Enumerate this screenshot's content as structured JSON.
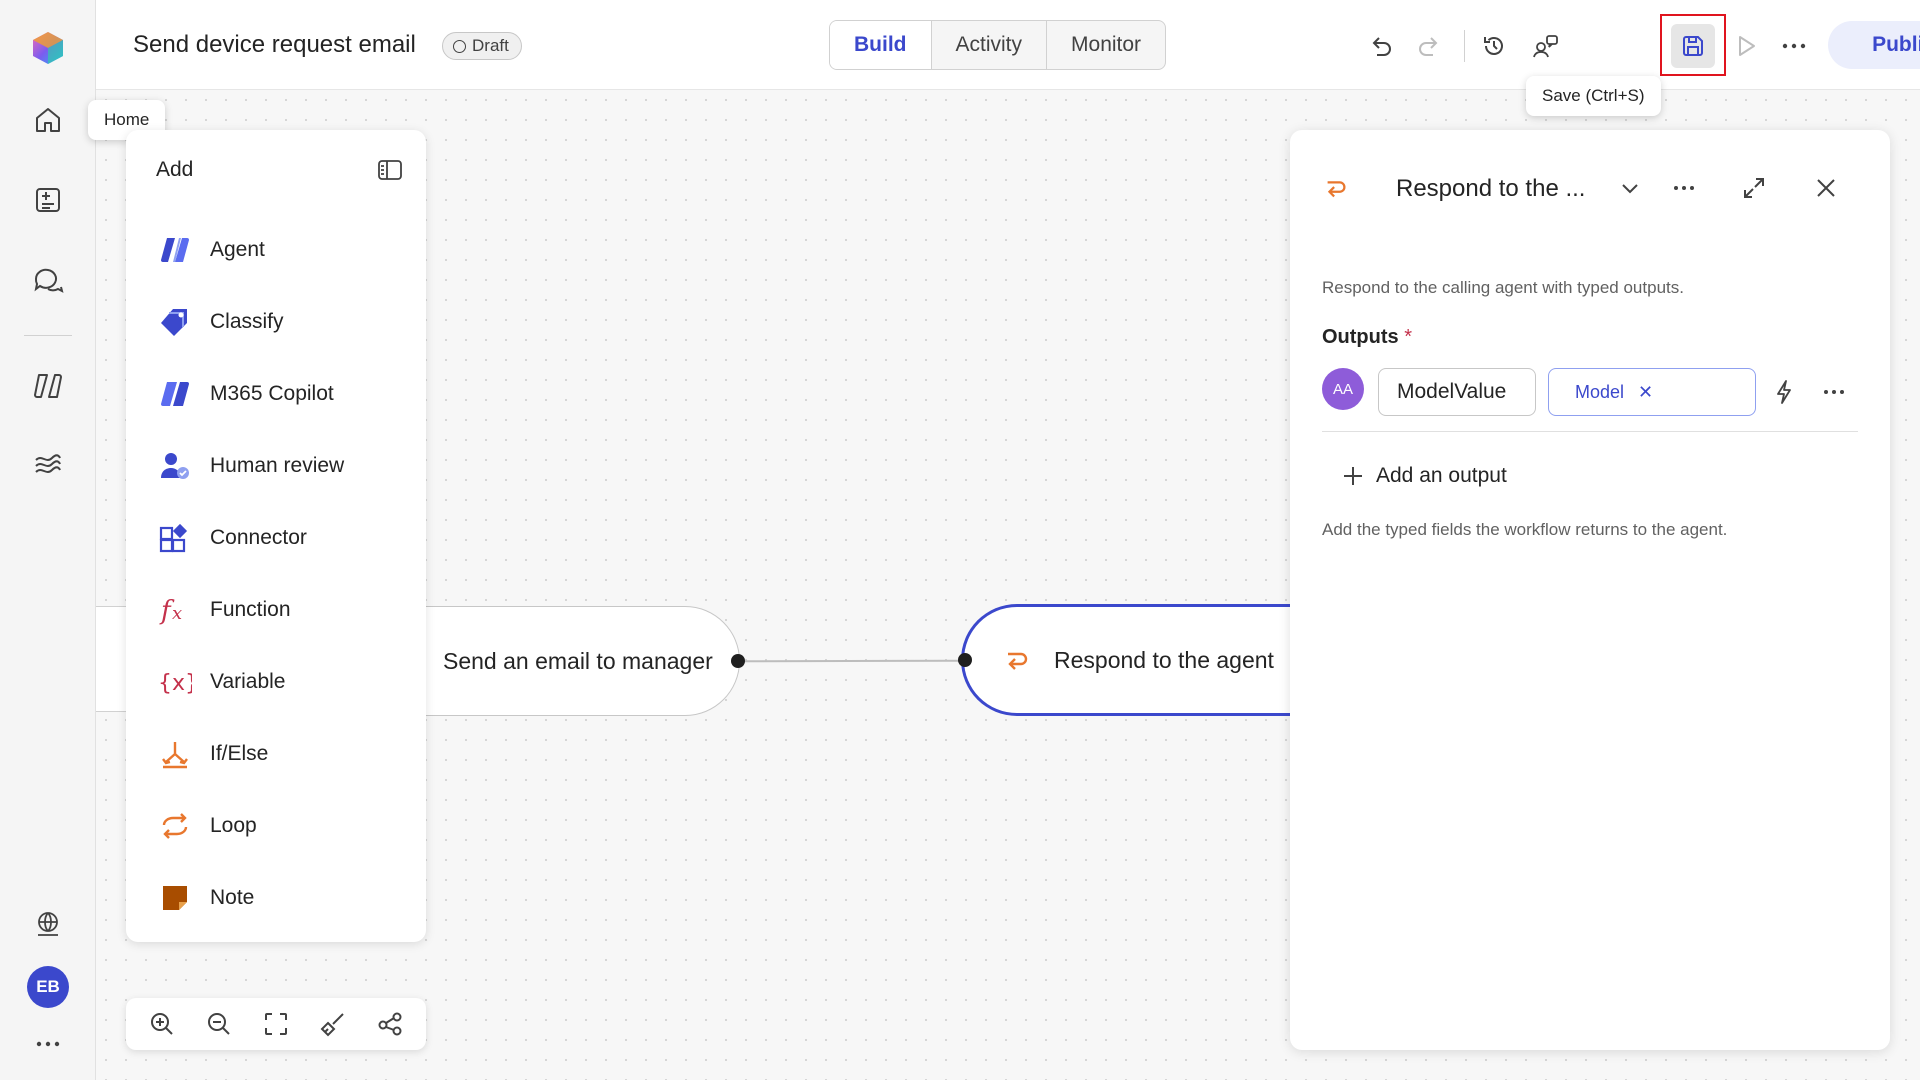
{
  "header": {
    "flow_title": "Send device request email",
    "status_badge": "Draft",
    "tabs": [
      {
        "label": "Build",
        "active": true
      },
      {
        "label": "Activity",
        "active": false
      },
      {
        "label": "Monitor",
        "active": false
      }
    ],
    "publish_label": "Publish",
    "save_tooltip": "Save (Ctrl+S)"
  },
  "rail": {
    "home_tooltip": "Home",
    "avatar_initials": "EB"
  },
  "add_panel": {
    "title": "Add",
    "items": [
      {
        "label": "Agent",
        "icon": "agent-icon"
      },
      {
        "label": "Classify",
        "icon": "classify-icon"
      },
      {
        "label": "M365 Copilot",
        "icon": "m365-copilot-icon"
      },
      {
        "label": "Human review",
        "icon": "human-review-icon"
      },
      {
        "label": "Connector",
        "icon": "connector-icon"
      },
      {
        "label": "Function",
        "icon": "function-icon"
      },
      {
        "label": "Variable",
        "icon": "variable-icon"
      },
      {
        "label": "If/Else",
        "icon": "if-else-icon"
      },
      {
        "label": "Loop",
        "icon": "loop-icon"
      },
      {
        "label": "Note",
        "icon": "note-icon"
      }
    ]
  },
  "canvas": {
    "nodes": [
      {
        "label": "Send an email to manager"
      },
      {
        "label": "Respond to the agent"
      }
    ]
  },
  "props_panel": {
    "title": "Respond to the ...",
    "description": "Respond to the calling agent with typed outputs.",
    "outputs_label": "Outputs",
    "required_marker": "*",
    "output_avatar": "AA",
    "output_name": "ModelValue",
    "output_type": "Model",
    "add_output_label": "Add an output",
    "hint": "Add the typed fields the workflow returns to the agent."
  },
  "colors": {
    "accent": "#3b48cc",
    "node_orange": "#e8772e",
    "highlight_red": "#e0141e"
  }
}
